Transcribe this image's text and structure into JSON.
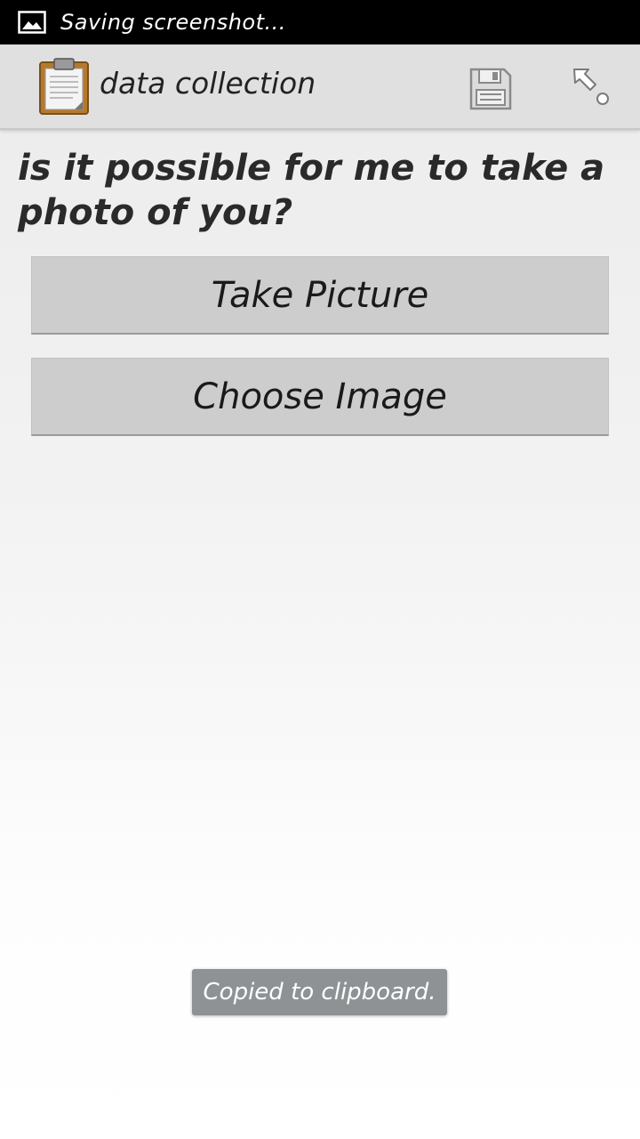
{
  "status_bar": {
    "notification_icon": "image-icon",
    "text": "Saving screenshot..."
  },
  "action_bar": {
    "app_icon": "clipboard-icon",
    "title": "data collection",
    "actions": [
      {
        "icon": "save-icon"
      },
      {
        "icon": "pointer-icon"
      }
    ]
  },
  "form": {
    "question": "is it possible for me to take a photo of you?",
    "take_picture_label": "Take Picture",
    "choose_image_label": "Choose Image"
  },
  "toast": {
    "text": "Copied to clipboard."
  }
}
